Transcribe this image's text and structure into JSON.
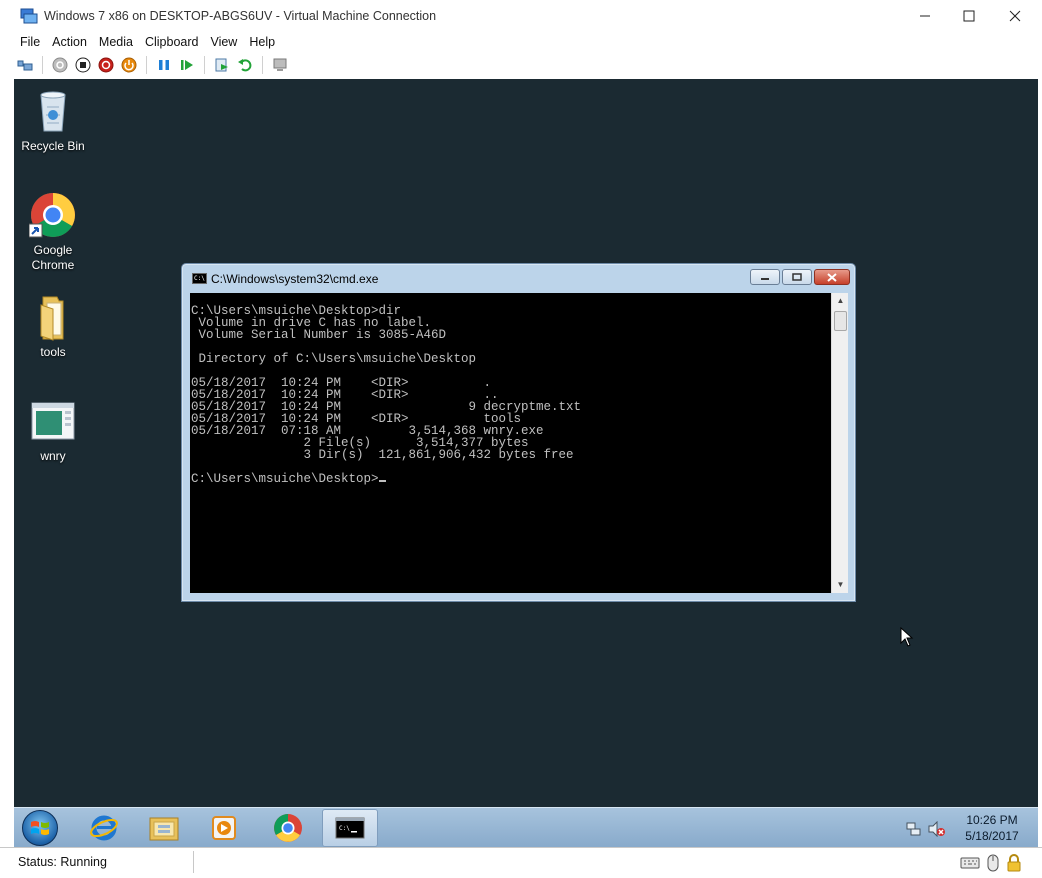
{
  "host": {
    "title": "Windows 7 x86 on DESKTOP-ABGS6UV - Virtual Machine Connection",
    "menu": [
      "File",
      "Action",
      "Media",
      "Clipboard",
      "View",
      "Help"
    ],
    "toolbar_icons": [
      "ctrl-alt-del-icon",
      "start-icon",
      "turn-off-icon",
      "shut-down-icon",
      "save-icon",
      "pause-icon",
      "resume-icon",
      "checkpoint-icon",
      "revert-icon",
      "enhanced-session-icon"
    ]
  },
  "desktop": {
    "icons": [
      {
        "label": "Recycle Bin",
        "icon": "recycle-bin-icon"
      },
      {
        "label": "Google\nChrome",
        "icon": "chrome-shortcut-icon"
      },
      {
        "label": "tools",
        "icon": "folder-icon"
      },
      {
        "label": "wnry",
        "icon": "application-icon"
      }
    ]
  },
  "cmd": {
    "title": "C:\\Windows\\system32\\cmd.exe",
    "output": "C:\\Users\\msuiche\\Desktop>dir\n Volume in drive C has no label.\n Volume Serial Number is 3085-A46D\n\n Directory of C:\\Users\\msuiche\\Desktop\n\n05/18/2017  10:24 PM    <DIR>          .\n05/18/2017  10:24 PM    <DIR>          ..\n05/18/2017  10:24 PM                 9 decryptme.txt\n05/18/2017  10:24 PM    <DIR>          tools\n05/18/2017  07:18 AM         3,514,368 wnry.exe\n               2 File(s)      3,514,377 bytes\n               3 Dir(s)  121,861,906,432 bytes free\n\n",
    "prompt": "C:\\Users\\msuiche\\Desktop>"
  },
  "taskbar": {
    "apps": [
      "internet-explorer-icon",
      "windows-explorer-icon",
      "media-player-icon",
      "chrome-icon",
      "command-prompt-icon"
    ],
    "active_app": "command-prompt-icon",
    "clock_time": "10:26 PM",
    "clock_date": "5/18/2017"
  },
  "status": {
    "text": "Status: Running"
  },
  "colors": {
    "desktop_bg": "#1b2a32",
    "console_bg": "#000000",
    "console_fg": "#c0c0c0"
  }
}
